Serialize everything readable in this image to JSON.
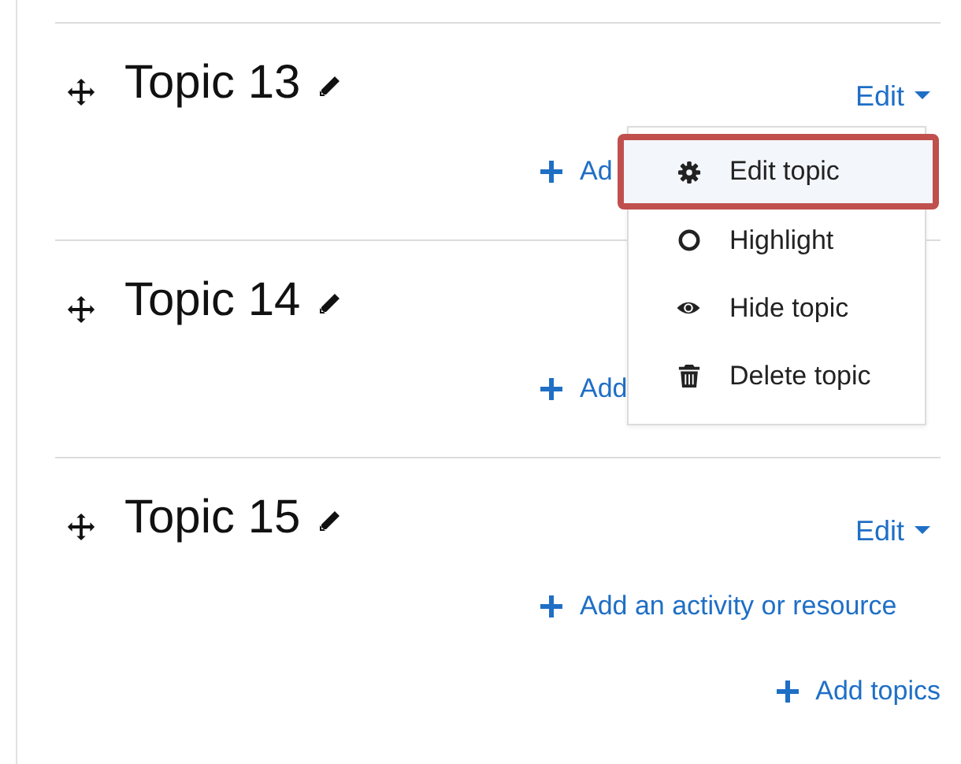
{
  "sections": [
    {
      "title": "Topic 13",
      "edit_label": "Edit",
      "add_link": "Ad"
    },
    {
      "title": "Topic 14",
      "add_link": "Add"
    },
    {
      "title": "Topic 15",
      "edit_label": "Edit",
      "add_link": "Add an activity or resource"
    }
  ],
  "add_topics": "Add topics",
  "menu": {
    "items": [
      {
        "label": "Edit topic",
        "kind": "gear",
        "selected": true
      },
      {
        "label": "Highlight",
        "kind": "circle",
        "selected": false
      },
      {
        "label": "Hide topic",
        "kind": "eye",
        "selected": false
      },
      {
        "label": "Delete topic",
        "kind": "trash",
        "selected": false
      }
    ]
  }
}
